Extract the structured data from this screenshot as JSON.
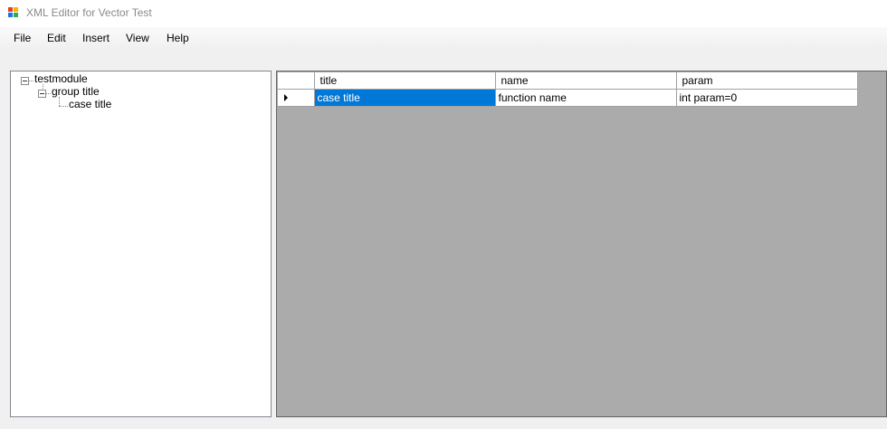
{
  "window": {
    "title": "XML Editor for Vector Test"
  },
  "menu": [
    "File",
    "Edit",
    "Insert",
    "View",
    "Help"
  ],
  "tree": {
    "root": "testmodule",
    "group": "group title",
    "case": "case title"
  },
  "grid": {
    "columns": [
      "title",
      "name",
      "param"
    ],
    "rows": [
      {
        "title": "case title",
        "name": "function name",
        "param": "int param=0"
      }
    ]
  },
  "colors": {
    "selection": "#0078d7",
    "grid_background": "#ababab",
    "icon": [
      "#e8401c",
      "#f4b400",
      "#1a73e8",
      "#34a853"
    ]
  }
}
